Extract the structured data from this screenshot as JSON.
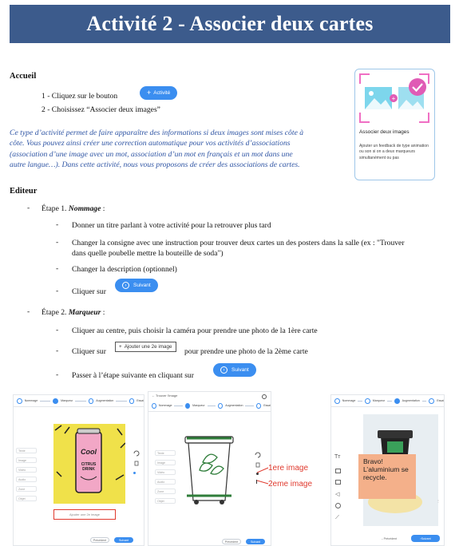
{
  "title": "Activité 2 - Associer deux cartes",
  "accueil": {
    "heading": "Accueil",
    "step1_prefix": "1 - Cliquez sur le bouton",
    "activite_button": "Activité",
    "step2": "2 - Choisissez “Associer deux images”",
    "intro_lines": [
      "Ce type d’activité permet de faire apparaître des informations si deux images sont mises côte à",
      "côte. Vous pouvez ainsi créer une correction automatique pour vos activités d’associations",
      "(association d’une image avec un mot, association d’un mot en français et un mot dans une",
      "autre langue…). Dans cette activité, nous vous proposons de créer des associations de cartes."
    ]
  },
  "card": {
    "title": "Associer deux images",
    "description": "Ajouter un feedback de type animation ou son si on a deux marqueurs simultanément ou pas"
  },
  "editeur": {
    "heading": "Editeur",
    "step1_prefix": "Étape 1. ",
    "step1_name": "Nommage",
    "step1_suffix": " :",
    "step1_items": [
      "Donner un titre parlant à votre activité pour la retrouver plus tard",
      "Changer la consigne avec une instruction pour trouver deux cartes un des posters dans la salle (ex : \"Trouver",
      "dans quelle poubelle mettre la bouteille de soda\")",
      "Changer la description (optionnel)"
    ],
    "cliquer_sur": "Cliquer sur",
    "suivant": "Suivant",
    "step2_prefix": "Étape 2. ",
    "step2_name": "Marqueur",
    "step2_suffix": " :",
    "step2_item1": "Cliquer au centre, puis choisir la caméra pour prendre une photo de la 1ère carte",
    "step2_item2_prefix": "Cliquer sur",
    "ajouter_button": "Ajouter une 2e image",
    "step2_item2_suffix": "pour prendre une photo de la 2ème carte",
    "step2_item3": "Passer à l’étape suivante en cliquant sur"
  },
  "screenshots": {
    "steps": [
      "Nommage",
      "Marqueur",
      "Augmentation",
      "Essai"
    ],
    "back_label": "Trouver l'image",
    "sidebar": [
      "Texte",
      "Image",
      "Vidéo",
      "Audio",
      "Zone",
      "Objet"
    ],
    "can_text": [
      "Cool",
      "CITRUS",
      "DRINK"
    ],
    "add_image": "Ajouter une 2e image",
    "precedent": "Précédent",
    "suivant": "Suivant",
    "annot1": "1ere image",
    "annot2": "2eme image",
    "bubble": [
      "Bravo!",
      "L’aluminium se",
      "recycle."
    ]
  },
  "colors": {
    "banner": "#3c5b8c",
    "accent": "#3b8ef0",
    "intro": "#2f55a4",
    "annotation": "#e03a2e"
  }
}
